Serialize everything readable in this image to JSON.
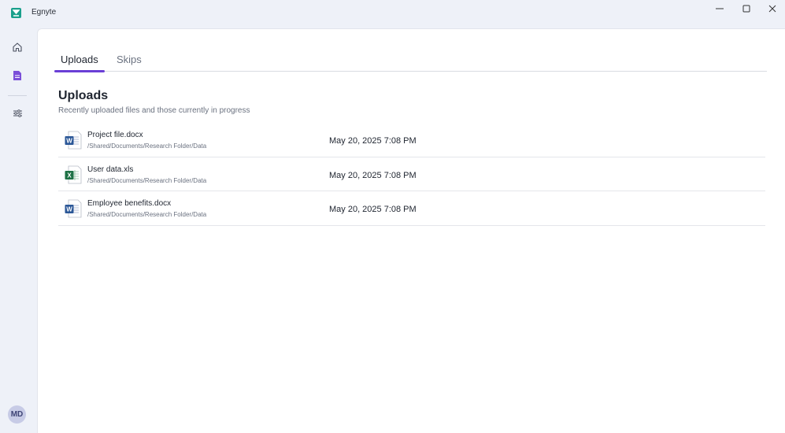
{
  "window": {
    "title": "Egnyte"
  },
  "sidebar": {
    "items": [
      {
        "icon": "home-icon"
      },
      {
        "icon": "document-icon",
        "active": true
      },
      {
        "icon": "settings-sliders-icon"
      }
    ],
    "avatar_initials": "MD"
  },
  "tabs": [
    {
      "label": "Uploads",
      "active": true
    },
    {
      "label": "Skips",
      "active": false
    }
  ],
  "section": {
    "title": "Uploads",
    "subtitle": "Recently uploaded files and those currently in progress"
  },
  "files": [
    {
      "name": "Project file.docx",
      "path": "/Shared/Documents/Research Folder/Data",
      "date": "May 20, 2025 7:08 PM",
      "type": "word"
    },
    {
      "name": "User data.xls",
      "path": "/Shared/Documents/Research Folder/Data",
      "date": "May 20, 2025 7:08 PM",
      "type": "excel"
    },
    {
      "name": "Employee benefits.docx",
      "path": "/Shared/Documents/Research Folder/Data",
      "date": "May 20, 2025 7:08 PM",
      "type": "word"
    }
  ],
  "colors": {
    "accent": "#6a3fd6",
    "brand": "#1aa08c",
    "word": "#2b5797",
    "excel": "#1e7145"
  }
}
